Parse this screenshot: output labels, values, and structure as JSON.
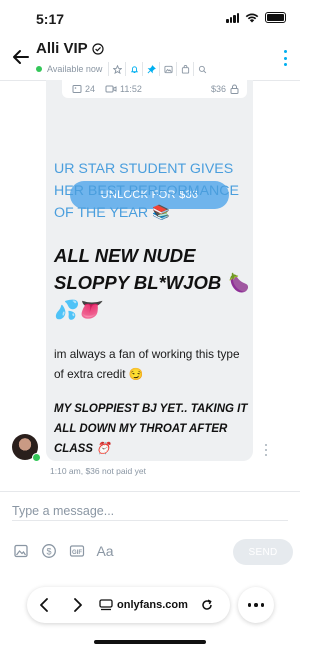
{
  "status_bar": {
    "time": "5:17"
  },
  "header": {
    "title": "Alli VIP",
    "availability": "Available now",
    "icons": [
      "star-icon",
      "bell-icon",
      "pin-icon",
      "image-icon",
      "shop-icon",
      "search-icon"
    ]
  },
  "message": {
    "media": {
      "photo_count": "24",
      "video_duration": "11:52",
      "price": "$36"
    },
    "unlock_label": "UNLOCK FOR $36",
    "headline": "UR STAR STUDENT GIVES HER BEST PERFORMANCE OF THE YEAR 📚",
    "big_line": "ALL NEW NUDE SLOPPY BL*WJOB 🍆💦👅",
    "body": "im always a fan of working this type of extra credit 😏",
    "italic_line": "MY SLOPPIEST BJ YET.. TAKING IT ALL DOWN MY THROAT AFTER CLASS ⏰",
    "time": "1:10 am,",
    "paid_status": "$36 not paid yet"
  },
  "composer": {
    "placeholder": "Type a message...",
    "aa_label": "Aa",
    "send_label": "SEND",
    "tool_icons": [
      "image-icon",
      "dollar-icon",
      "gif-icon"
    ]
  },
  "browser": {
    "url": "onlyfans.com"
  },
  "colors": {
    "accent": "#00aff0",
    "unlock_button": "#6fb4ec",
    "headline_text": "#4a9edd",
    "online": "#34c759"
  }
}
